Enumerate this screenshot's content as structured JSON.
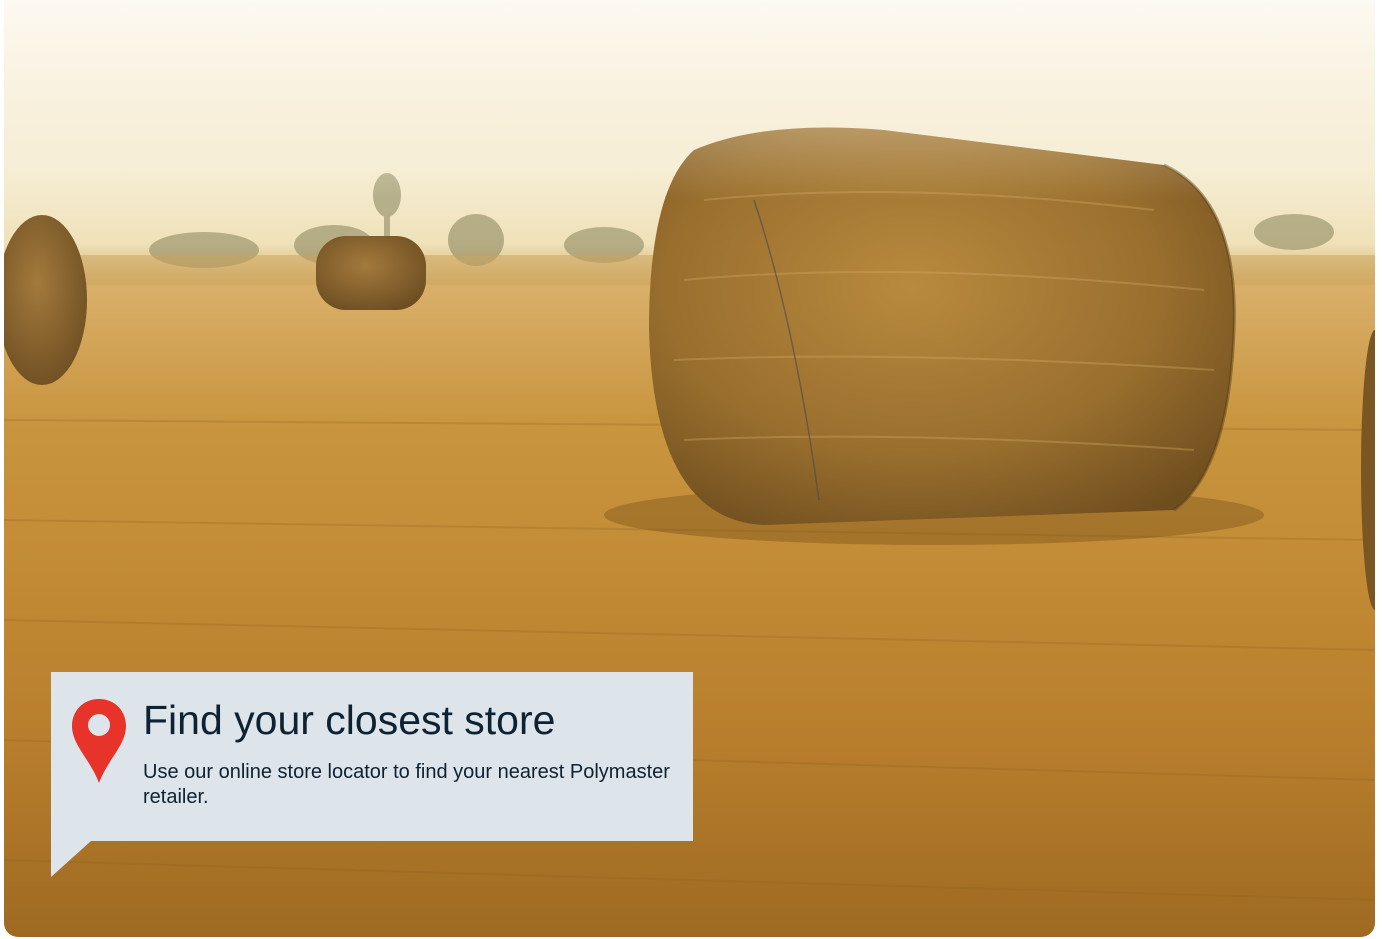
{
  "promo": {
    "title": "Find your closest store",
    "description": "Use our online store locator to find your nearest Polymaster retailer."
  },
  "icons": {
    "location": "map-pin-icon"
  },
  "colors": {
    "pin": "#e8332a",
    "card_bg": "#dde4ea",
    "text": "#0d2233"
  }
}
